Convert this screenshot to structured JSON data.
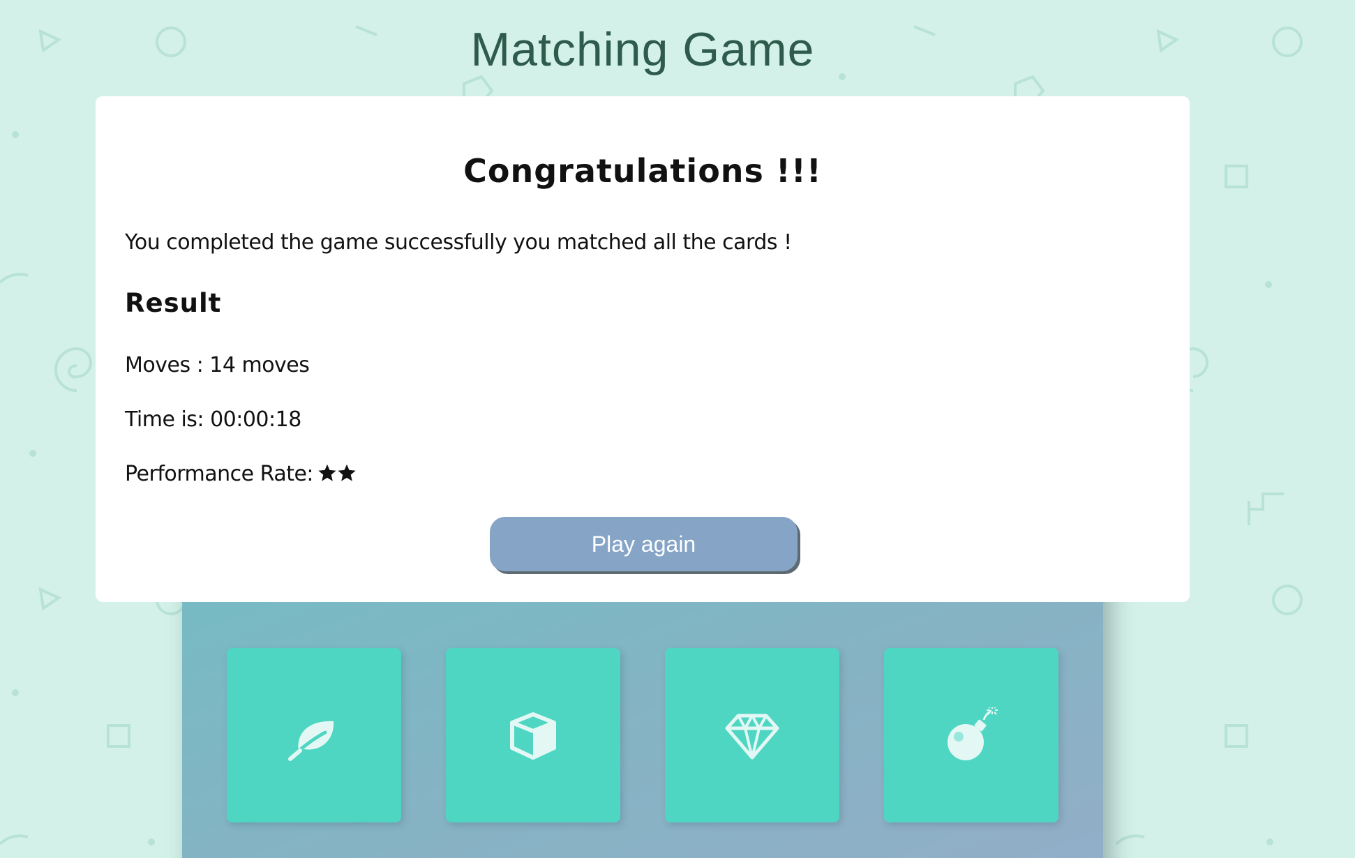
{
  "page": {
    "title": "Matching Game",
    "background_color": "#d3f1e8"
  },
  "deck": {
    "card_color": "#4fd6c3",
    "visible_cards": [
      {
        "icon": "leaf-icon"
      },
      {
        "icon": "cube-icon"
      },
      {
        "icon": "diamond-icon"
      },
      {
        "icon": "bomb-icon"
      }
    ]
  },
  "modal": {
    "heading": "Congratulations !!!",
    "message": "You completed the game successfully you matched all the cards !",
    "result_heading": "Result",
    "moves_text": "Moves : 14 moves",
    "time_text": "Time is: 00:00:18",
    "rating_label": "Performance Rate:",
    "stars": 2,
    "star_icon": "star-icon",
    "button_label": "Play again",
    "button_color": "#85a4c6"
  }
}
